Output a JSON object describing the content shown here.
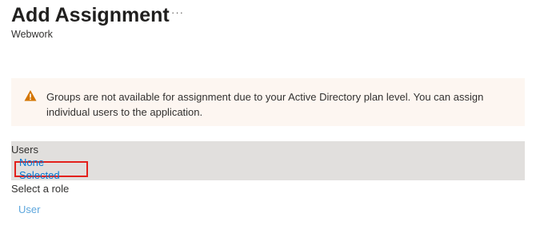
{
  "header": {
    "title": "Add Assignment",
    "more_label": "···",
    "subtitle": "Webwork"
  },
  "warning": {
    "icon": "warning-icon",
    "icon_color": "#d47500",
    "text": "Groups are not available for assignment due to your Active Directory plan level. You can assign individual users to the application."
  },
  "users": {
    "label": "Users",
    "selection": "None Selected"
  },
  "role": {
    "label": "Select a role",
    "value": "User"
  },
  "colors": {
    "link": "#0078d4",
    "highlight_border": "#e3211c",
    "warning_bg": "#fdf6f1",
    "users_bg": "#e1dfdd"
  }
}
